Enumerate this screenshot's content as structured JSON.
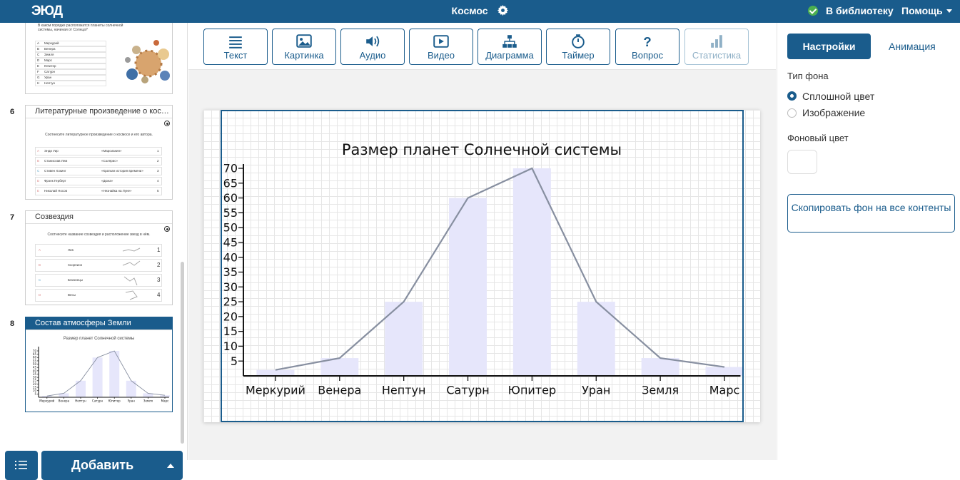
{
  "header": {
    "logo": "ЭЮД",
    "title": "Космос",
    "library_label": "В библиотеку",
    "help_label": "Помощь",
    "icons": [
      "gear-icon",
      "check-circle-icon",
      "caret-down-icon"
    ]
  },
  "slides": [
    {
      "question": "В каком порядке расположатся планеты солнечной системы, начиная от Солнца?",
      "rows": [
        [
          "A",
          "Меркурий"
        ],
        [
          "B",
          "Венера"
        ],
        [
          "C",
          "Земля"
        ],
        [
          "D",
          "Марс"
        ],
        [
          "E",
          "Юпитер"
        ],
        [
          "F",
          "Сатурн"
        ],
        [
          "G",
          "Уран"
        ],
        [
          "H",
          "Нептун"
        ]
      ]
    },
    {
      "number": "6",
      "title": "Литературные произведение о косм...",
      "question": "Соотнесите литературное произведение о космосе и его автора.",
      "rows": [
        [
          "A",
          "Энди Уир",
          "«Марсианин»",
          "1"
        ],
        [
          "B",
          "Станислав Лем",
          "«Солярис»",
          "2"
        ],
        [
          "C",
          "Стивен Хокинг",
          "«Краткая история времени»",
          "3"
        ],
        [
          "D",
          "Фрэнк Герберт",
          "«Дюна»",
          "4"
        ],
        [
          "E",
          "Николай Носов",
          "«Незнайка на Луне»",
          "5"
        ]
      ]
    },
    {
      "number": "7",
      "title": "Созвездия",
      "question": "Соотнесите название созвездия и расположение звезд в нём.",
      "rows": [
        [
          "A",
          "Лев",
          "1"
        ],
        [
          "B",
          "Скорпион",
          "2"
        ],
        [
          "C",
          "Близнецы",
          "3"
        ],
        [
          "D",
          "Весы",
          "4"
        ]
      ]
    },
    {
      "number": "8",
      "title": "Состав атмосферы Земли",
      "chart_title": "Размер планет Солнечной системы"
    }
  ],
  "sidebar_buttons": {
    "add_label": "Добавить",
    "icons": [
      "list-icon",
      "caret-up-icon"
    ]
  },
  "toolbar": {
    "items": [
      {
        "label": "Текст",
        "icon": "text-icon",
        "enabled": true
      },
      {
        "label": "Картинка",
        "icon": "image-icon",
        "enabled": true
      },
      {
        "label": "Аудио",
        "icon": "audio-icon",
        "enabled": true
      },
      {
        "label": "Видео",
        "icon": "video-icon",
        "enabled": true
      },
      {
        "label": "Диаграмма",
        "icon": "diagram-icon",
        "enabled": true
      },
      {
        "label": "Таймер",
        "icon": "timer-icon",
        "enabled": true
      },
      {
        "label": "Вопрос",
        "icon": "question-icon",
        "enabled": true
      },
      {
        "label": "Статистика",
        "icon": "stats-icon",
        "enabled": false
      }
    ]
  },
  "chart_data": {
    "type": "bar",
    "title": "Размер планет Солнечной системы",
    "categories": [
      "Меркурий",
      "Венера",
      "Нептун",
      "Сатурн",
      "Юпитер",
      "Уран",
      "Земля",
      "Марс"
    ],
    "series": [
      {
        "type": "bar",
        "values": [
          2,
          6,
          25,
          60,
          70,
          25,
          6,
          3
        ]
      },
      {
        "type": "line",
        "values": [
          2,
          6,
          25,
          60,
          70,
          25,
          6,
          3
        ]
      }
    ],
    "yticks": [
      5,
      10,
      15,
      20,
      25,
      30,
      35,
      40,
      45,
      50,
      55,
      60,
      65,
      70
    ],
    "ylim": [
      0,
      70
    ],
    "grid": false,
    "bar_color": "#e6e6fb",
    "line_color": "#878fa0"
  },
  "right_panel": {
    "tab_settings": "Настройки",
    "tab_animation": "Анимация",
    "bg_type_label": "Тип фона",
    "radio_solid": "Сплошной цвет",
    "radio_image": "Изображение",
    "bg_color_label": "Фоновый цвет",
    "background_color": "#ffffff",
    "copy_button": "Скопировать фон на все контенты"
  },
  "colors": {
    "brand": "#1a5c8c",
    "success": "#4caf50"
  }
}
